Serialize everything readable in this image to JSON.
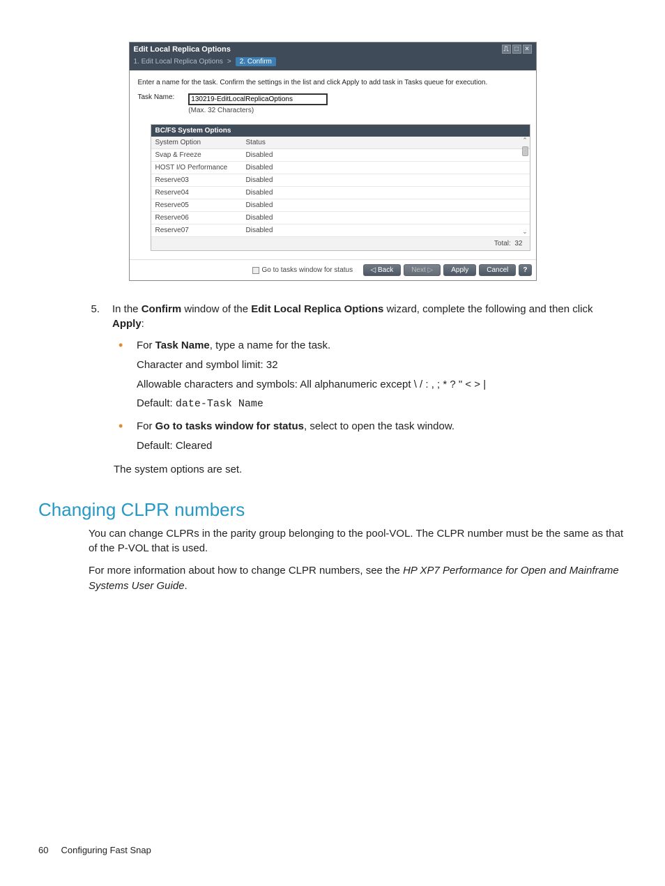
{
  "wizard": {
    "title": "Edit Local Replica Options",
    "step1": "1. Edit Local Replica Options",
    "chev": ">",
    "step2": "2. Confirm",
    "instruction": "Enter a name for the task. Confirm the settings in the list and click Apply to add task in Tasks queue for execution.",
    "task_label": "Task Name:",
    "task_value": "130219-EditLocalReplicaOptions",
    "task_hint": "(Max. 32 Characters)",
    "options_header": "BC/FS System Options",
    "col_option": "System Option",
    "col_status": "Status",
    "rows": [
      {
        "option": "Svap & Freeze",
        "status": "Disabled"
      },
      {
        "option": "HOST I/O Performance",
        "status": "Disabled"
      },
      {
        "option": "Reserve03",
        "status": "Disabled"
      },
      {
        "option": "Reserve04",
        "status": "Disabled"
      },
      {
        "option": "Reserve05",
        "status": "Disabled"
      },
      {
        "option": "Reserve06",
        "status": "Disabled"
      },
      {
        "option": "Reserve07",
        "status": "Disabled"
      }
    ],
    "total_label": "Total:",
    "total_value": "32",
    "go_tasks": "Go to tasks window for status",
    "back": "Back",
    "next": "Next",
    "apply": "Apply",
    "cancel": "Cancel",
    "help": "?"
  },
  "doc": {
    "step_num": "5.",
    "step_text_pre": "In the ",
    "step_confirm": "Confirm",
    "step_mid": " window of the ",
    "step_wizname": "Edit Local Replica Options",
    "step_tail": " wizard, complete the following and then click ",
    "step_apply": "Apply",
    "step_colon": ":",
    "bullet1_pre": "For ",
    "bullet1_b": "Task Name",
    "bullet1_tail": ", type a name for the task.",
    "bullet1_line2": "Character and symbol limit: 32",
    "bullet1_line3": "Allowable characters and symbols: All alphanumeric except \\ / : , ; * ? \" < > |",
    "bullet1_line4_pre": "Default: ",
    "bullet1_line4_code": "date-Task Name",
    "bullet2_pre": "For ",
    "bullet2_b": "Go to tasks window for status",
    "bullet2_tail": ", select to open the task window.",
    "bullet2_line2": "Default: Cleared",
    "conclusion": "The system options are set.",
    "heading": "Changing CLPR numbers",
    "para1": "You can change CLPRs in the parity group belonging to the pool-VOL. The CLPR number must be the same as that of the P-VOL that is used.",
    "para2_pre": "For more information about how to change CLPR numbers, see the ",
    "para2_em": "HP XP7 Performance for Open and Mainframe Systems User Guide",
    "para2_tail": "."
  },
  "footer": {
    "page": "60",
    "section": "Configuring Fast Snap"
  }
}
